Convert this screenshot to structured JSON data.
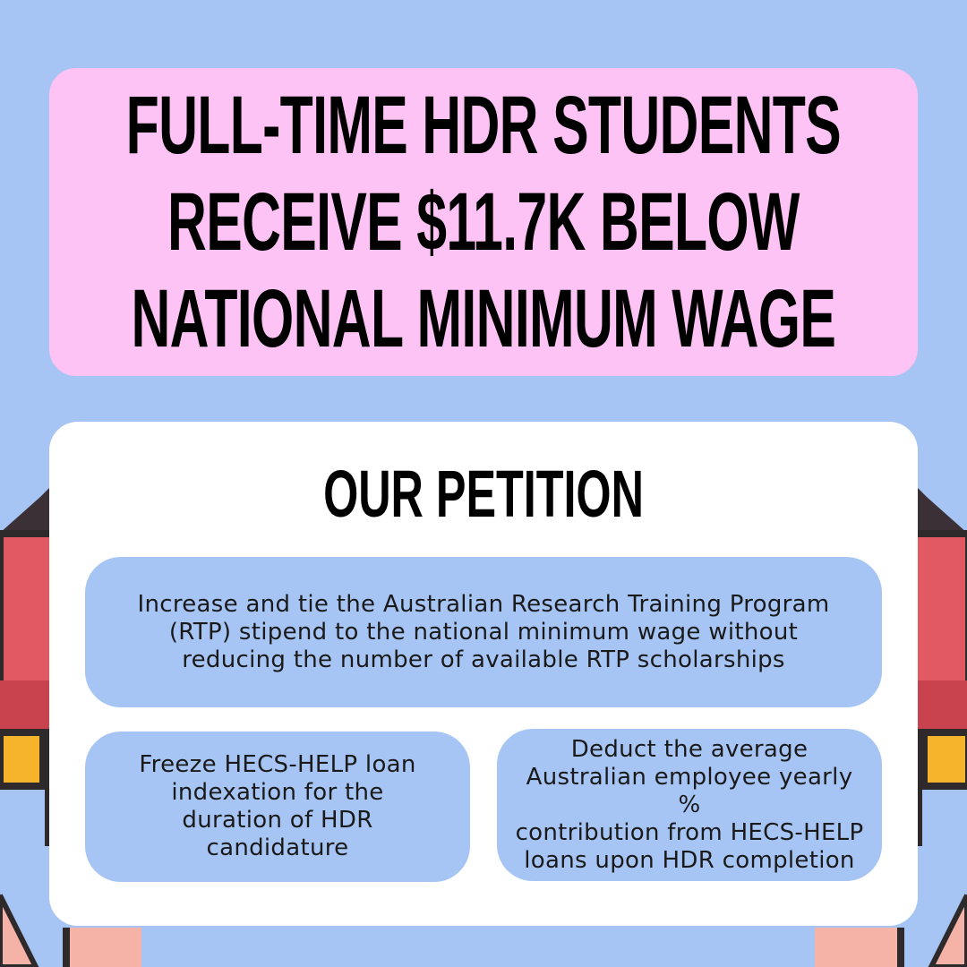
{
  "headline": {
    "lines": [
      "FULL-TIME HDR STUDENTS",
      "RECEIVE $11.7K BELOW",
      "NATIONAL MINIMUM WAGE"
    ]
  },
  "petition": {
    "title": "OUR PETITION",
    "points": [
      {
        "lines": [
          "Increase and tie the Australian Research Training Program",
          "(RTP) stipend to the national minimum wage without",
          "reducing the number of available RTP scholarships"
        ]
      },
      {
        "lines": [
          "Freeze HECS-HELP loan",
          "indexation for the",
          "duration of HDR",
          "candidature"
        ]
      },
      {
        "lines": [
          "Deduct the average",
          "Australian employee yearly %",
          "contribution from HECS-HELP",
          "loans upon HDR completion"
        ]
      }
    ]
  },
  "colors": {
    "background": "#a7c5f4",
    "headline_box": "#fdc3f4",
    "card": "#ffffff",
    "pill": "#a7c5f4",
    "sign_red": "#e15a63",
    "sign_yellow": "#f5b42c",
    "skin": "#f4b3a6"
  },
  "decor": {
    "illustration": "protest-sign-held-by-hands"
  }
}
